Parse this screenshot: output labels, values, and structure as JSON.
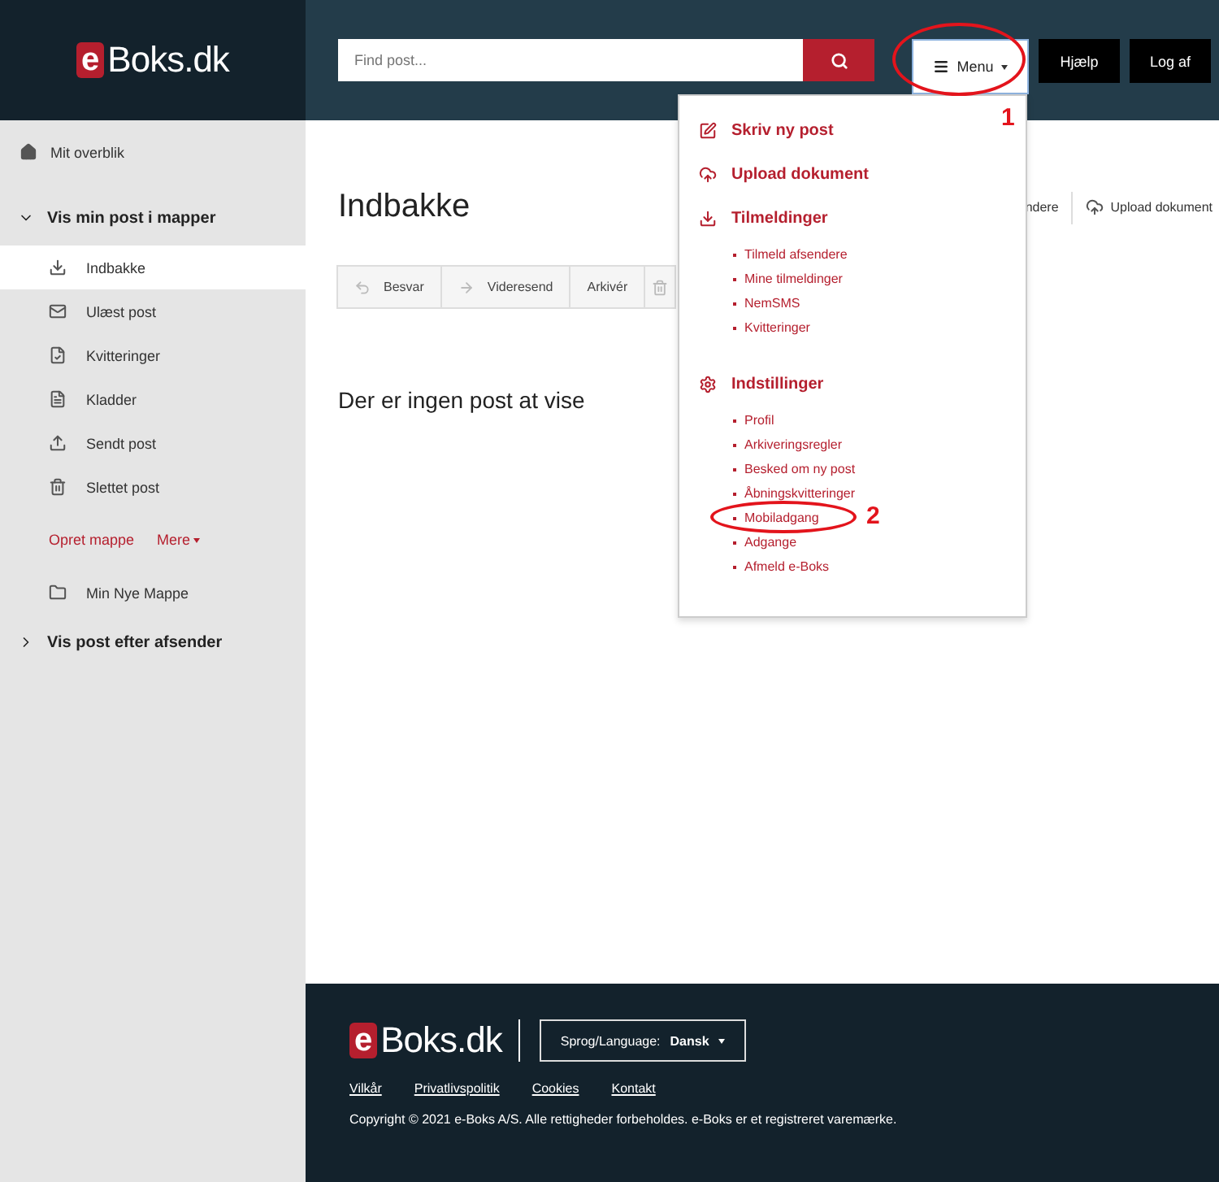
{
  "header": {
    "logo": {
      "mark": "e",
      "text": "Boks.dk"
    },
    "search": {
      "placeholder": "Find post..."
    },
    "menu_button": {
      "label": "Menu",
      "expanded": true,
      "annotation": "1"
    },
    "buttons": [
      "Hjælp",
      "Log af"
    ]
  },
  "sidebar": {
    "overview": "Mit overblik",
    "sections": [
      {
        "label": "Vis min post i mapper",
        "expanded": true,
        "items": [
          {
            "label": "Indbakke",
            "selected": true
          },
          {
            "label": "Ulæst post",
            "selected": false
          },
          {
            "label": "Kvitteringer",
            "selected": false
          },
          {
            "label": "Kladder",
            "selected": false
          },
          {
            "label": "Sendt post",
            "selected": false
          },
          {
            "label": "Slettet post",
            "selected": false
          }
        ],
        "actions": [
          "Opret mappe",
          "Mere"
        ],
        "folders": [
          {
            "label": "Min Nye Mappe",
            "selected": false
          }
        ]
      },
      {
        "label": "Vis post efter afsender",
        "expanded": false
      }
    ]
  },
  "main": {
    "title": "Indbakke",
    "actions": [
      "ndere",
      "Upload dokument"
    ],
    "toolbar": [
      "Besvar",
      "Videresend",
      "Arkivér"
    ],
    "empty_message": "Der er ingen post at vise"
  },
  "dropdown": {
    "sections": [
      {
        "label": "Skriv ny post"
      },
      {
        "label": "Upload dokument"
      },
      {
        "label": "Tilmeldinger",
        "links": [
          {
            "label": "Tilmeld afsendere"
          },
          {
            "label": "Mine tilmeldinger"
          },
          {
            "label": "NemSMS"
          },
          {
            "label": "Kvitteringer"
          }
        ]
      },
      {
        "label": "Indstillinger",
        "links": [
          {
            "label": "Profil"
          },
          {
            "label": "Arkiveringsregler"
          },
          {
            "label": "Besked om ny post"
          },
          {
            "label": "Åbningskvitteringer"
          },
          {
            "label": "Mobiladgang",
            "annotation": "2"
          },
          {
            "label": "Adgange"
          },
          {
            "label": "Afmeld e-Boks"
          }
        ]
      }
    ]
  },
  "footer": {
    "logo": {
      "mark": "e",
      "text": "Boks.dk"
    },
    "language": {
      "label": "Sprog/Language:",
      "value": "Dansk"
    },
    "links": [
      "Vilkår",
      "Privatlivspolitik",
      "Cookies",
      "Kontakt"
    ],
    "copyright": "Copyright © 2021 e-Boks A/S. Alle rettigheder forbeholdes. e-Boks er et registreret varemærke."
  }
}
